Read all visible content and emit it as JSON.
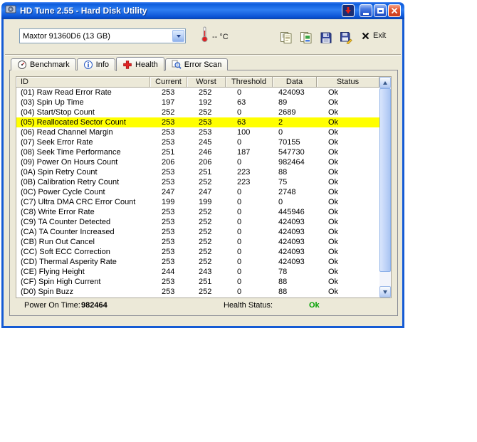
{
  "window": {
    "title": "HD Tune 2.55 - Hard Disk Utility"
  },
  "toolbar": {
    "drive_select": "Maxtor 91360D6 (13 GB)",
    "temp": "-- °C",
    "exit_label": "Exit"
  },
  "tabs": [
    {
      "label": "Benchmark",
      "icon": "gauge-icon",
      "active": false
    },
    {
      "label": "Info",
      "icon": "info-icon",
      "active": false
    },
    {
      "label": "Health",
      "icon": "health-cross-icon",
      "active": true
    },
    {
      "label": "Error Scan",
      "icon": "magnifier-icon",
      "active": false
    }
  ],
  "table": {
    "headers": [
      "ID",
      "Current",
      "Worst",
      "Threshold",
      "Data",
      "Status"
    ],
    "highlight_color": "#ffff00",
    "rows": [
      {
        "id": "(01) Raw Read Error Rate",
        "current": "253",
        "worst": "252",
        "threshold": "0",
        "data": "424093",
        "status": "Ok",
        "highlighted": false
      },
      {
        "id": "(03) Spin Up Time",
        "current": "197",
        "worst": "192",
        "threshold": "63",
        "data": "89",
        "status": "Ok",
        "highlighted": false
      },
      {
        "id": "(04) Start/Stop Count",
        "current": "252",
        "worst": "252",
        "threshold": "0",
        "data": "2689",
        "status": "Ok",
        "highlighted": false
      },
      {
        "id": "(05) Reallocated Sector Count",
        "current": "253",
        "worst": "253",
        "threshold": "63",
        "data": "2",
        "status": "Ok",
        "highlighted": true
      },
      {
        "id": "(06) Read Channel Margin",
        "current": "253",
        "worst": "253",
        "threshold": "100",
        "data": "0",
        "status": "Ok",
        "highlighted": false
      },
      {
        "id": "(07) Seek Error Rate",
        "current": "253",
        "worst": "245",
        "threshold": "0",
        "data": "70155",
        "status": "Ok",
        "highlighted": false
      },
      {
        "id": "(08) Seek Time Performance",
        "current": "251",
        "worst": "246",
        "threshold": "187",
        "data": "547730",
        "status": "Ok",
        "highlighted": false
      },
      {
        "id": "(09) Power On Hours Count",
        "current": "206",
        "worst": "206",
        "threshold": "0",
        "data": "982464",
        "status": "Ok",
        "highlighted": false
      },
      {
        "id": "(0A) Spin Retry Count",
        "current": "253",
        "worst": "251",
        "threshold": "223",
        "data": "88",
        "status": "Ok",
        "highlighted": false
      },
      {
        "id": "(0B) Calibration Retry Count",
        "current": "253",
        "worst": "252",
        "threshold": "223",
        "data": "75",
        "status": "Ok",
        "highlighted": false
      },
      {
        "id": "(0C) Power Cycle Count",
        "current": "247",
        "worst": "247",
        "threshold": "0",
        "data": "2748",
        "status": "Ok",
        "highlighted": false
      },
      {
        "id": "(C7) Ultra DMA CRC Error Count",
        "current": "199",
        "worst": "199",
        "threshold": "0",
        "data": "0",
        "status": "Ok",
        "highlighted": false
      },
      {
        "id": "(C8) Write Error Rate",
        "current": "253",
        "worst": "252",
        "threshold": "0",
        "data": "445946",
        "status": "Ok",
        "highlighted": false
      },
      {
        "id": "(C9) TA Counter Detected",
        "current": "253",
        "worst": "252",
        "threshold": "0",
        "data": "424093",
        "status": "Ok",
        "highlighted": false
      },
      {
        "id": "(CA) TA Counter Increased",
        "current": "253",
        "worst": "252",
        "threshold": "0",
        "data": "424093",
        "status": "Ok",
        "highlighted": false
      },
      {
        "id": "(CB) Run Out Cancel",
        "current": "253",
        "worst": "252",
        "threshold": "0",
        "data": "424093",
        "status": "Ok",
        "highlighted": false
      },
      {
        "id": "(CC) Soft ECC Correction",
        "current": "253",
        "worst": "252",
        "threshold": "0",
        "data": "424093",
        "status": "Ok",
        "highlighted": false
      },
      {
        "id": "(CD) Thermal Asperity Rate",
        "current": "253",
        "worst": "252",
        "threshold": "0",
        "data": "424093",
        "status": "Ok",
        "highlighted": false
      },
      {
        "id": "(CE) Flying Height",
        "current": "244",
        "worst": "243",
        "threshold": "0",
        "data": "78",
        "status": "Ok",
        "highlighted": false
      },
      {
        "id": "(CF) Spin High Current",
        "current": "253",
        "worst": "251",
        "threshold": "0",
        "data": "88",
        "status": "Ok",
        "highlighted": false
      },
      {
        "id": "(D0) Spin Buzz",
        "current": "253",
        "worst": "252",
        "threshold": "0",
        "data": "88",
        "status": "Ok",
        "highlighted": false
      }
    ]
  },
  "footer": {
    "power_on_label": "Power On Time:",
    "power_on_value": "982464",
    "health_label": "Health Status:",
    "health_value": "Ok",
    "health_color": "#00a000"
  }
}
